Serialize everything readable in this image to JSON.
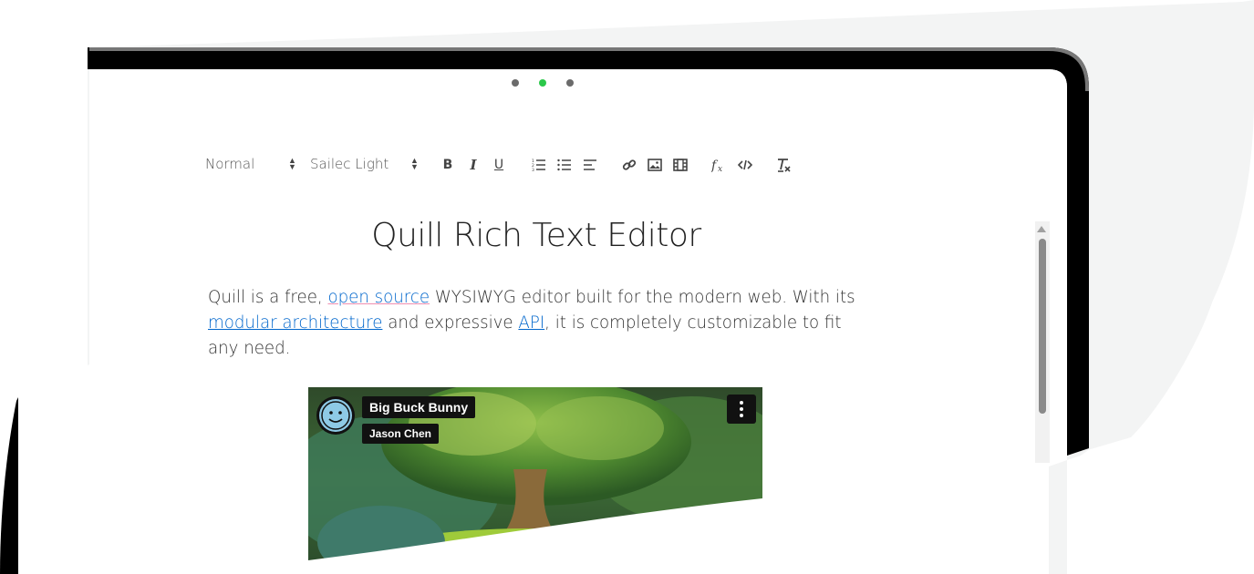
{
  "device": {
    "window_dots": [
      {
        "name": "dot-left",
        "color": "#6b6b6b"
      },
      {
        "name": "dot-active",
        "color": "#2bc84a"
      },
      {
        "name": "dot-right",
        "color": "#6b6b6b"
      }
    ]
  },
  "toolbar": {
    "header_select": "Normal",
    "font_select": "Sailec Light",
    "bold_label": "B",
    "italic_label": "I",
    "underline_label": "U",
    "icons": [
      "ordered-list-icon",
      "bullet-list-icon",
      "align-icon",
      "link-icon",
      "image-icon",
      "video-icon",
      "formula-icon",
      "code-block-icon",
      "clean-format-icon"
    ]
  },
  "document": {
    "title": "Quill Rich Text Editor",
    "paragraph": {
      "t1": "Quill is a free, ",
      "link_open_source": "open source",
      "t2": " WYSIWYG editor built for the modern web. With its ",
      "link_modular": "modular architecture",
      "t3": " and expressive ",
      "link_api": "API",
      "t4": ", it is completely customizable to fit any need."
    },
    "link_color": "#0066cc"
  },
  "video": {
    "title": "Big Buck Bunny",
    "author": "Jason Chen"
  },
  "colors": {
    "device_frame": "#000000",
    "background_blob": "#f3f4f4",
    "text": "#333333"
  }
}
